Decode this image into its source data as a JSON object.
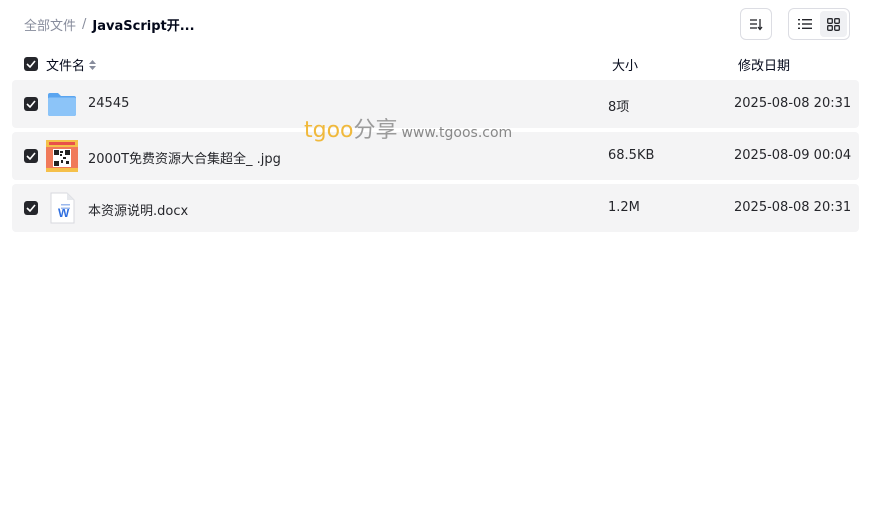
{
  "breadcrumb": {
    "root": "全部文件",
    "separator": "/",
    "current": "JavaScript开..."
  },
  "toolbar": {
    "sort_icon": "sort-icon",
    "view_list_icon": "list-view-icon",
    "view_grid_icon": "grid-view-icon"
  },
  "columns": {
    "name": "文件名",
    "size": "大小",
    "date": "修改日期"
  },
  "files": [
    {
      "name": "24545",
      "size": "8项",
      "date": "2025-08-08 20:31",
      "icon": "folder-icon",
      "checked": true
    },
    {
      "name": "2000T免费资源大合集超全_ .jpg",
      "size": "68.5KB",
      "date": "2025-08-09 00:04",
      "icon": "image-thumbnail-icon",
      "checked": true
    },
    {
      "name": "本资源说明.docx",
      "size": "1.2M",
      "date": "2025-08-08 20:31",
      "icon": "word-doc-icon",
      "checked": true
    }
  ],
  "watermark": {
    "logo": "tgoo",
    "logo_cn": "分享",
    "url": "www.tgoos.com"
  },
  "colors": {
    "row_bg": "#f4f4f5",
    "checkbox": "#25262b",
    "folder": "#6fb3f5",
    "word": "#2f6fe0"
  }
}
